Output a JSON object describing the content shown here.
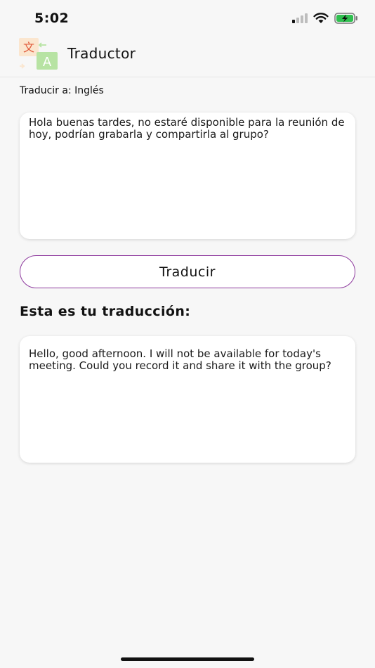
{
  "status_bar": {
    "time": "5:02"
  },
  "header": {
    "title": "Traductor",
    "logo_glyphs": {
      "source": "文",
      "target": "A"
    }
  },
  "target_language_label": "Traducir a: Inglés",
  "input": {
    "text": "Hola buenas tardes, no estaré disponible para la reunión de hoy, podrían grabarla y compartirla al grupo?"
  },
  "translate_button_label": "Traducir",
  "result": {
    "heading": "Esta es tu traducción:",
    "text": "Hello, good afternoon. I will not be available for today's meeting. Could you record it and share it with the group?"
  },
  "colors": {
    "accent": "#8e3a9e",
    "background": "#f7f7f7",
    "card": "#ffffff"
  }
}
